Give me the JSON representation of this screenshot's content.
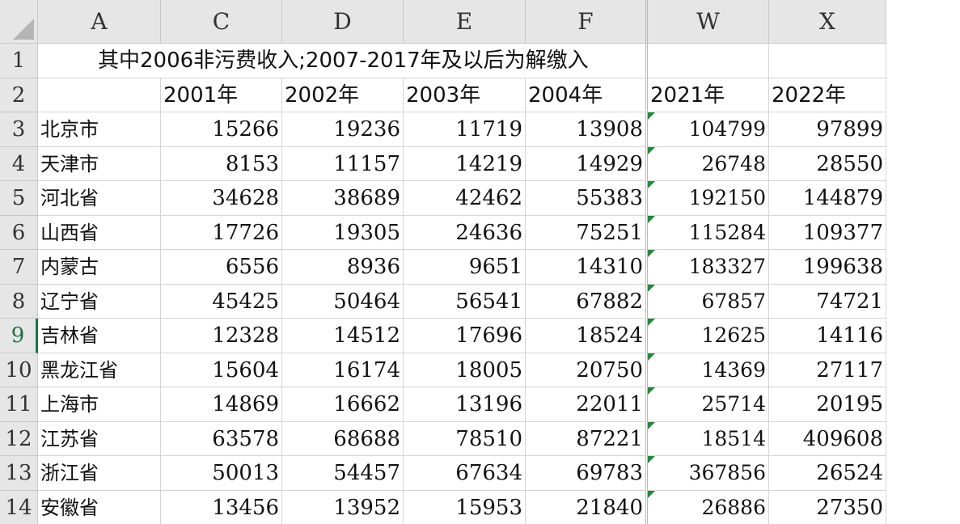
{
  "columns": [
    "A",
    "C",
    "D",
    "E",
    "F",
    "W",
    "X"
  ],
  "row1_text": "其中2006非污费收入;2007-2017年及以后为解缴入",
  "years": [
    "2001年",
    "2002年",
    "2003年",
    "2004年",
    "2021年",
    "2022年"
  ],
  "rows": [
    {
      "num": "1"
    },
    {
      "num": "2"
    },
    {
      "num": "3",
      "name": "北京市",
      "values": [
        "15266",
        "19236",
        "11719",
        "13908",
        "104799",
        "97899"
      ]
    },
    {
      "num": "4",
      "name": "天津市",
      "values": [
        "8153",
        "11157",
        "14219",
        "14929",
        "26748",
        "28550"
      ]
    },
    {
      "num": "5",
      "name": "河北省",
      "values": [
        "34628",
        "38689",
        "42462",
        "55383",
        "192150",
        "144879"
      ]
    },
    {
      "num": "6",
      "name": "山西省",
      "values": [
        "17726",
        "19305",
        "24636",
        "75251",
        "115284",
        "109377"
      ]
    },
    {
      "num": "7",
      "name": "内蒙古",
      "values": [
        "6556",
        "8936",
        "9651",
        "14310",
        "183327",
        "199638"
      ]
    },
    {
      "num": "8",
      "name": "辽宁省",
      "values": [
        "45425",
        "50464",
        "56541",
        "67882",
        "67857",
        "74721"
      ]
    },
    {
      "num": "9",
      "name": "吉林省",
      "values": [
        "12328",
        "14512",
        "17696",
        "18524",
        "12625",
        "14116"
      ]
    },
    {
      "num": "10",
      "name": "黑龙江省",
      "values": [
        "15604",
        "16174",
        "18005",
        "20750",
        "14369",
        "27117"
      ]
    },
    {
      "num": "11",
      "name": "上海市",
      "values": [
        "14869",
        "16662",
        "13196",
        "22011",
        "25714",
        "20195"
      ]
    },
    {
      "num": "12",
      "name": "江苏省",
      "values": [
        "63578",
        "68688",
        "78510",
        "87221",
        "18514",
        "409608"
      ]
    },
    {
      "num": "13",
      "name": "浙江省",
      "values": [
        "50013",
        "54457",
        "67634",
        "69783",
        "367856",
        "26524"
      ]
    },
    {
      "num": "14",
      "name": "安徽省",
      "values": [
        "13456",
        "13952",
        "15953",
        "21840",
        "26886",
        "27350"
      ]
    }
  ],
  "colors": {
    "header_bg": "#e6e6e6",
    "active_row": "#1e7145",
    "error_flag": "#1e8a3a"
  }
}
